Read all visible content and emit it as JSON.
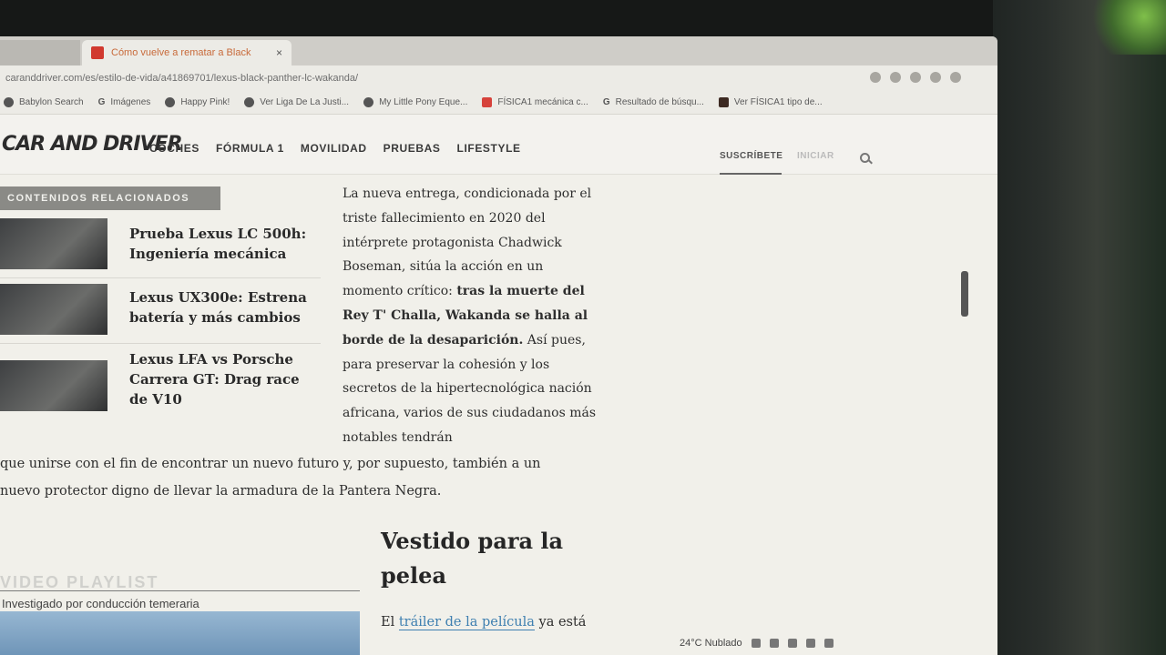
{
  "browser": {
    "tab_title": "Cómo vuelve a rematar a Black",
    "tab_close": "×",
    "url": "caranddriver.com/es/estilo-de-vida/a41869701/lexus-black-panther-lc-wakanda/"
  },
  "bookmarks": [
    {
      "label": "Babylon Search",
      "icon": "dot-icon"
    },
    {
      "label": "Imágenes",
      "icon": "google-icon"
    },
    {
      "label": "Happy Pink!",
      "icon": "globe-icon"
    },
    {
      "label": "Ver Liga De La Justi...",
      "icon": "globe-icon"
    },
    {
      "label": "My Little Pony Eque...",
      "icon": "globe-icon"
    },
    {
      "label": "FÍSICA1 mecánica c...",
      "icon": "red-square-icon"
    },
    {
      "label": "Resultado de búsqu...",
      "icon": "google-icon"
    },
    {
      "label": "Ver FÍSICA1 tipo de...",
      "icon": "dark-square-icon"
    }
  ],
  "site": {
    "logo": "CAR AND DRIVER",
    "nav": [
      "COCHES",
      "FÓRMULA 1",
      "MOVILIDAD",
      "PRUEBAS",
      "LIFESTYLE"
    ],
    "subscribe": "SUSCRÍBETE",
    "login": "INICIAR"
  },
  "related": {
    "label": "CONTENIDOS RELACIONADOS",
    "items": [
      {
        "title": "Prueba Lexus LC 500h: Ingeniería mecánica"
      },
      {
        "title": "Lexus UX300e: Estrena batería y más cambios"
      },
      {
        "title": "Lexus LFA vs Porsche Carrera GT: Drag race de V10"
      }
    ]
  },
  "article": {
    "p1_a": "La nueva entrega, condicionada por el triste fallecimiento en 2020 del intérprete protagonista Chadwick Boseman, sitúa la acción en un momento crítico: ",
    "p1_bold": "tras la muerte del Rey T' Challa, Wakanda se halla al borde de la desaparición.",
    "p1_b": " Así pues, para preservar la cohesión y los secretos de la hipertecnológica nación africana, varios de sus ciudadanos más notables tendrán",
    "line2": "que unirse con el fin de encontrar un nuevo futuro y, por supuesto, también a un",
    "line3": "nuevo protector digno de llevar la armadura de la Pantera Negra.",
    "heading": "Vestido para la pelea",
    "last_a": "El ",
    "last_link": "tráiler de la película",
    "last_b": " ya está"
  },
  "video": {
    "head": "VIDEO PLAYLIST",
    "caption": "Investigado por conducción temeraria"
  },
  "tray": {
    "weather": "24°C  Nublado"
  }
}
